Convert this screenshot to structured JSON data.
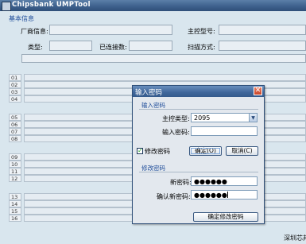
{
  "app": {
    "title": "Chipsbank UMPTool"
  },
  "info": {
    "section_title": "基本信息",
    "vendor_label": "厂商信息:",
    "controller_label": "主控型号:",
    "type_label": "类型:",
    "connected_label": "已连接数:",
    "scan_mode_label": "扫描方式:"
  },
  "ports": [
    "01",
    "02",
    "03",
    "04",
    "05",
    "06",
    "07",
    "08",
    "09",
    "10",
    "11",
    "12",
    "13",
    "14",
    "15",
    "16"
  ],
  "footer": {
    "company": "深圳芯邦"
  },
  "dialog": {
    "title": "输入密码",
    "input_group_title": "输入密码",
    "controller_type_label": "主控类型:",
    "controller_type_value": "2095",
    "password_label": "输入密码:",
    "password_value": "",
    "modify_checkbox_label": "修改密码",
    "modify_checked": true,
    "ok_label": "确定(O)",
    "cancel_label": "取消(C)",
    "modify_group_title": "修改密码",
    "new_password_label": "新密码:",
    "new_password_value": "●●●●●●",
    "confirm_password_label": "确认新密码:",
    "confirm_password_value": "●●●●●●",
    "confirm_modify_label": "确定修改密码"
  },
  "icons": {
    "close": "close-icon",
    "dropdown": "chevron-down-icon",
    "check": "check-icon"
  },
  "colors": {
    "titlebar": "#3c5f8b",
    "section_title": "#1f4d9a",
    "background": "#d9e6ee",
    "close_button": "#c8452a"
  }
}
